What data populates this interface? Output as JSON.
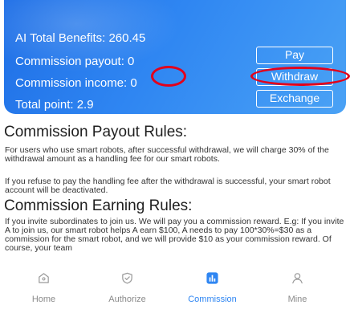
{
  "summary": {
    "total_benefits": "AI Total Benefits: 260.45",
    "commission_payout": "Commission payout: 0",
    "commission_income": "Commission income: 0",
    "total_point": "Total point: 2.9"
  },
  "buttons": {
    "pay": "Pay",
    "withdraw": "Withdraw",
    "exchange": "Exchange"
  },
  "payout_rules": {
    "title": "Commission Payout Rules:",
    "paragraph1": "For users who use smart robots, after successful withdrawal, we will charge 30% of the withdrawal amount as a handling fee for our smart robots.",
    "paragraph2": "If you refuse to pay the handling fee after the withdrawal is successful, your smart robot account will be deactivated."
  },
  "earning_rules": {
    "title": "Commission Earning Rules:",
    "paragraph": "If you invite subordinates to join us. We will pay you a commission reward. E.g: If you invite A to join us, our smart robot helps A earn $100, A needs to pay 100*30%=$30 as a commission for the smart robot, and we will provide $10 as your commission reward. Of course, your team"
  },
  "tabbar": {
    "active": "Commission",
    "active_color": "#2f86f2",
    "items": [
      {
        "label": "Home",
        "icon": "home-icon"
      },
      {
        "label": "Authorize",
        "icon": "shield-check-icon"
      },
      {
        "label": "Commission",
        "icon": "bar-chart-icon"
      },
      {
        "label": "Mine",
        "icon": "user-icon"
      }
    ]
  },
  "colors": {
    "card": "#2f86f2",
    "highlight": "#e3001b"
  }
}
